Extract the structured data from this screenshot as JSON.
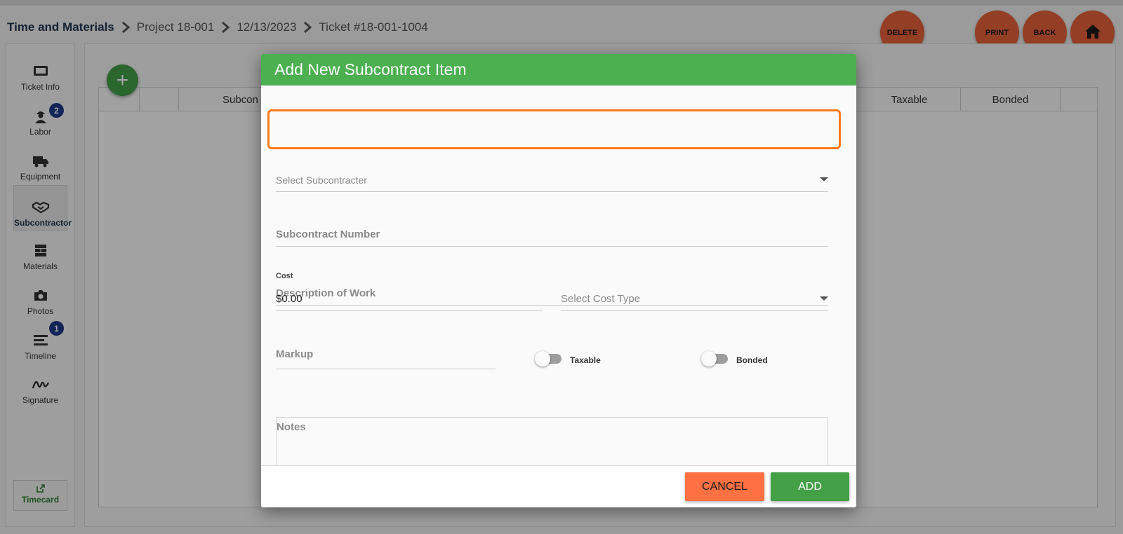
{
  "breadcrumb": {
    "root": "Time and Materials",
    "project": "Project 18-001",
    "date": "12/13/2023",
    "ticket": "Ticket #18-001-1004"
  },
  "top_buttons": {
    "delete": "DELETE",
    "print": "PRINT",
    "back": "BACK",
    "home_icon": "home-icon"
  },
  "sidebar": {
    "items": [
      {
        "label": "Ticket Info",
        "icon": "ticket-icon"
      },
      {
        "label": "Labor",
        "icon": "worker-icon",
        "badge": "2"
      },
      {
        "label": "Equipment",
        "icon": "truck-icon"
      },
      {
        "label": "Subcontractor",
        "icon": "handshake-icon",
        "active": true
      },
      {
        "label": "Materials",
        "icon": "bricks-icon"
      },
      {
        "label": "Photos",
        "icon": "camera-icon"
      },
      {
        "label": "Timeline",
        "icon": "list-icon",
        "badge": "1"
      },
      {
        "label": "Signature",
        "icon": "signature-icon"
      }
    ],
    "timecard": {
      "label": "Timecard",
      "icon": "external-link-icon"
    }
  },
  "table": {
    "columns": [
      "",
      "",
      "Subcon",
      "Taxable",
      "Bonded"
    ]
  },
  "modal": {
    "title": "Add New Subcontract Item",
    "subcontractor_placeholder": "Select Subcontracter",
    "subcontract_number_label": "Subcontract Number",
    "description_label": "Description of Work",
    "cost_label": "Cost",
    "cost_value": "$0.00",
    "cost_type_placeholder": "Select Cost Type",
    "markup_label": "Markup",
    "taxable_label": "Taxable",
    "taxable_on": false,
    "bonded_label": "Bonded",
    "bonded_on": false,
    "notes_label": "Notes",
    "cancel_label": "CANCEL",
    "add_label": "ADD"
  },
  "colors": {
    "header_green": "#4caf50",
    "accent_orange": "#e8623a",
    "highlight_orange": "#ff7a1a",
    "badge_blue": "#1f3a8a"
  }
}
